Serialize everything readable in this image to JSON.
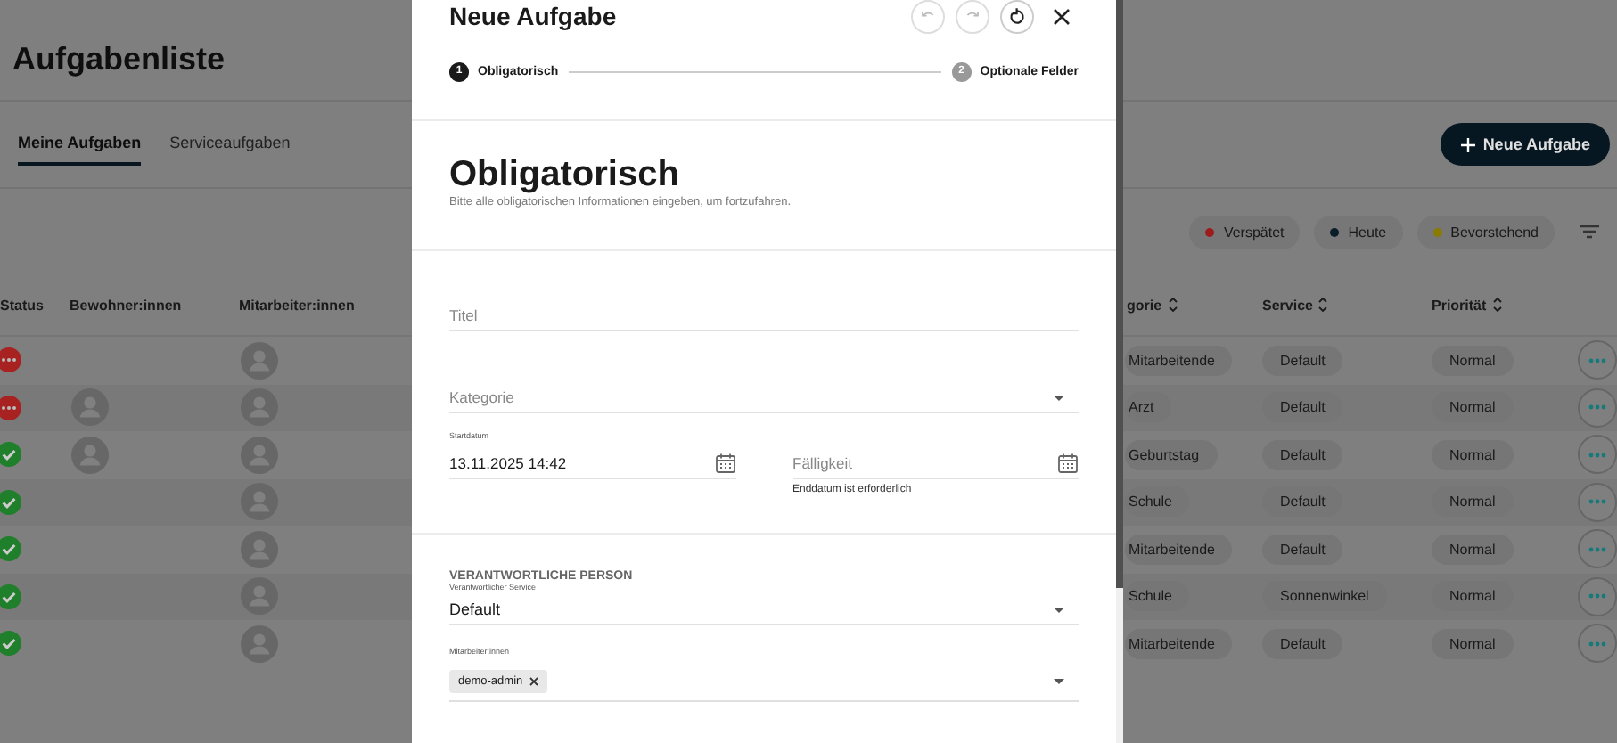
{
  "page": {
    "title": "Aufgabenliste",
    "tabs": [
      {
        "label": "Meine Aufgaben",
        "selected": true
      },
      {
        "label": "Serviceaufgaben",
        "selected": false
      }
    ],
    "new_button": {
      "label": "Neue Aufgabe"
    },
    "filters": [
      {
        "label": "Verspätet",
        "color": "#9c1c1c"
      },
      {
        "label": "Heute",
        "color": "#0a1d28"
      },
      {
        "label": "Bevorstehend",
        "color": "#8a7a00"
      }
    ],
    "table": {
      "columns": [
        {
          "label": "Status",
          "sortable": false
        },
        {
          "label": "Bewohner:innen",
          "sortable": false
        },
        {
          "label": "Mitarbeiter:innen",
          "sortable": false
        },
        {
          "label": "gorie",
          "sortable": true
        },
        {
          "label": "Service",
          "sortable": true
        },
        {
          "label": "Priorität",
          "sortable": true
        }
      ],
      "rows": [
        {
          "kind": "overdue",
          "resident": false,
          "category": "Mitarbeitende",
          "service": "Default",
          "priority": "Normal"
        },
        {
          "kind": "overdue",
          "resident": true,
          "category": "Arzt",
          "service": "Default",
          "priority": "Normal"
        },
        {
          "kind": "done",
          "resident": true,
          "category": "Geburtstag",
          "service": "Default",
          "priority": "Normal"
        },
        {
          "kind": "done",
          "resident": false,
          "category": "Schule",
          "service": "Default",
          "priority": "Normal"
        },
        {
          "kind": "done",
          "resident": false,
          "category": "Mitarbeitende",
          "service": "Default",
          "priority": "Normal"
        },
        {
          "kind": "done",
          "resident": false,
          "category": "Schule",
          "service": "Sonnenwinkel",
          "priority": "Normal"
        },
        {
          "kind": "done",
          "resident": false,
          "category": "Mitarbeitende",
          "service": "Default",
          "priority": "Normal"
        }
      ]
    }
  },
  "dialog": {
    "title": "Neue Aufgabe",
    "actions": [
      {
        "kind": "undo",
        "disabled": true
      },
      {
        "kind": "redo",
        "disabled": true
      },
      {
        "kind": "reset",
        "disabled": false
      },
      {
        "kind": "close",
        "disabled": false
      }
    ],
    "steps": [
      {
        "number": "1",
        "label": "Obligatorisch",
        "selected": true
      },
      {
        "number": "2",
        "label": "Optionale Felder",
        "selected": false
      }
    ],
    "heading": "Obligatorisch",
    "subtitle": "Bitte alle obligatorischen Informationen eingeben, um fortzufahren.",
    "title_field": {
      "placeholder": "Titel"
    },
    "category_field": {
      "placeholder": "Kategorie"
    },
    "start_date": {
      "label": "Startdatum",
      "value": "13.11.2025 14:42"
    },
    "due_date": {
      "placeholder": "Fälligkeit",
      "error": "Enddatum ist erforderlich"
    },
    "responsible": {
      "heading": "VERANTWORTLICHE PERSON",
      "service_label": "Verantwortlicher Service",
      "service_value": "Default",
      "staff_label": "Mitarbeiter:innen",
      "staff": [
        {
          "label": "demo-admin"
        }
      ]
    }
  }
}
